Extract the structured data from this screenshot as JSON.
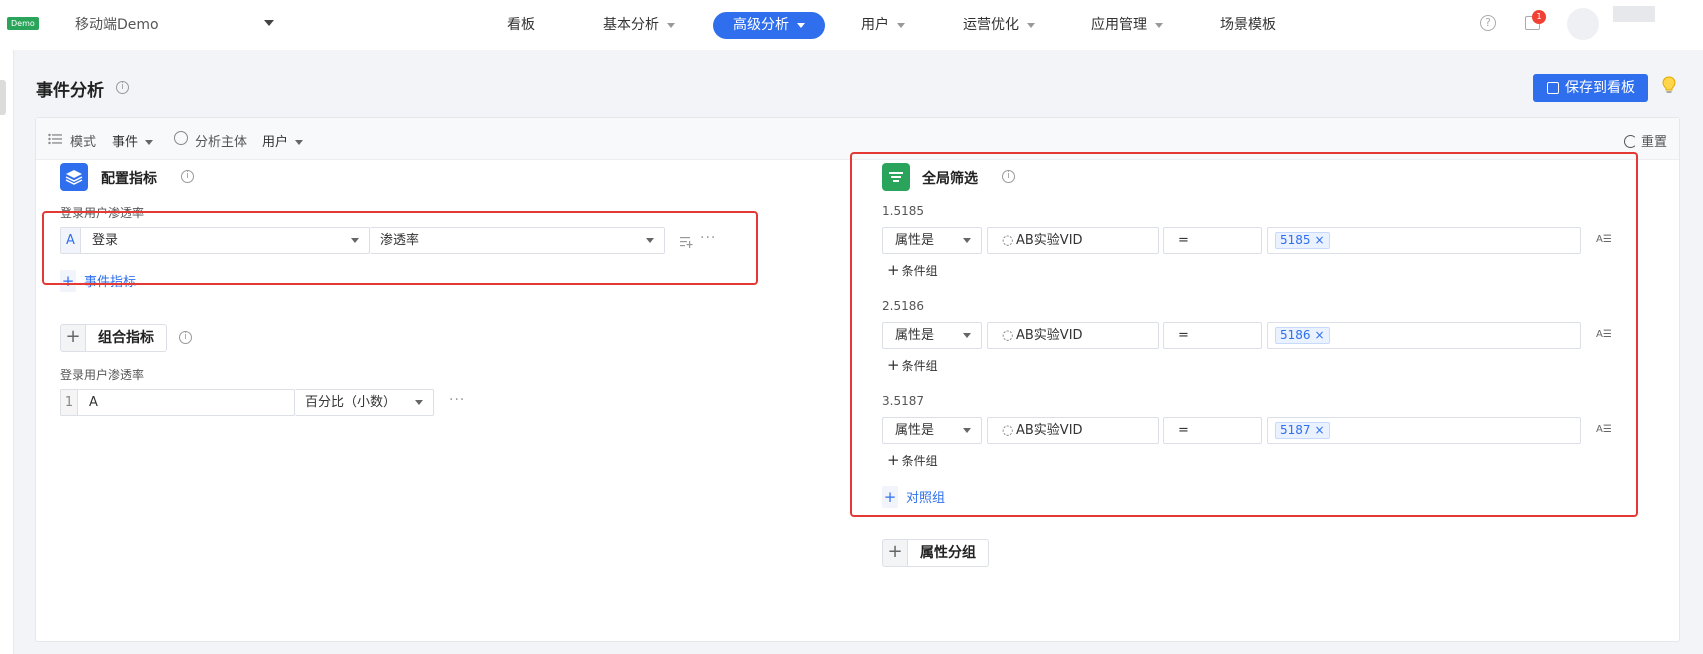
{
  "topbar": {
    "demo_badge": "Demo",
    "app_name": "移动端Demo",
    "nav": [
      {
        "label": "看板",
        "has_caret": false
      },
      {
        "label": "基本分析",
        "has_caret": true
      },
      {
        "label": "高级分析",
        "has_caret": true,
        "active": true
      },
      {
        "label": "用户",
        "has_caret": true
      },
      {
        "label": "运营优化",
        "has_caret": true
      },
      {
        "label": "应用管理",
        "has_caret": true
      },
      {
        "label": "场景模板",
        "has_caret": false
      }
    ],
    "help_glyph": "?",
    "msg_count": "1"
  },
  "page": {
    "title": "事件分析",
    "save_button": "保存到看板",
    "info_glyph": "i"
  },
  "toolbar": {
    "mode_label": "模式",
    "mode_value": "事件",
    "subject_label": "分析主体",
    "subject_value": "用户",
    "reset_label": "重置"
  },
  "metrics": {
    "config_title": "配置指标",
    "metric_name": "登录用户渗透率",
    "metric_prefix": "A",
    "event_value": "登录",
    "measure_value": "渗透率",
    "add_event_metric": "事件指标",
    "combo_title": "组合指标",
    "combo_name": "登录用户渗透率",
    "combo_prefix": "1",
    "combo_formula": "A",
    "combo_format": "百分比（小数）",
    "ellipsis": "···",
    "plus": "+"
  },
  "filters": {
    "title": "全局筛选",
    "groups": [
      {
        "name": "1.5185",
        "prop_op": "属性是",
        "prop": "AB实验VID",
        "op": "=",
        "value": "5185",
        "add_cond": "条件组"
      },
      {
        "name": "2.5186",
        "prop_op": "属性是",
        "prop": "AB实验VID",
        "op": "=",
        "value": "5186",
        "add_cond": "条件组"
      },
      {
        "name": "3.5187",
        "prop_op": "属性是",
        "prop": "AB实验VID",
        "op": "=",
        "value": "5187",
        "add_cond": "条件组"
      }
    ],
    "add_control": "对照组",
    "attr_group": "属性分组",
    "tag_close": "×",
    "sort_glyph": "A☰"
  }
}
